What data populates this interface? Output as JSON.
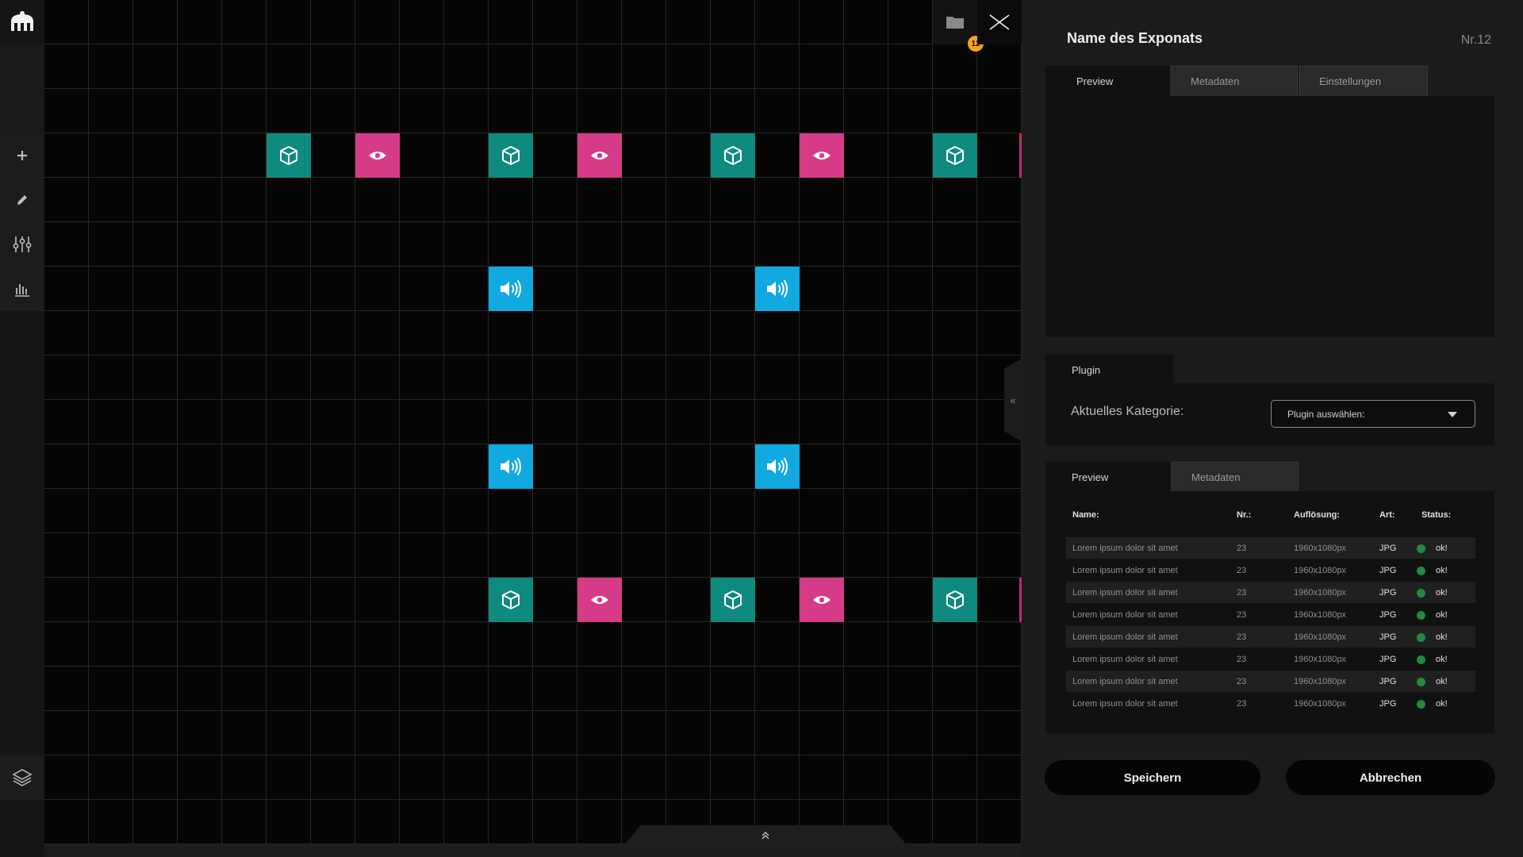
{
  "panel": {
    "title": "Name des Exponats",
    "number": "Nr.12",
    "top_tabs": [
      "Preview",
      "Metadaten",
      "Einstellungen"
    ],
    "plugin_tab": "Plugin",
    "category_label": "Aktuelles Kategorie:",
    "plugin_select_value": "Plugin auswählen:",
    "bottom_tabs": [
      "Preview",
      "Metadaten"
    ],
    "table": {
      "headers": [
        "Name:",
        "Nr.:",
        "Auflösung:",
        "Art:",
        "Status:"
      ],
      "rows": [
        {
          "name": "Lorem ipsum dolor sit amet",
          "nr": "23",
          "res": "1960x1080px",
          "art": "JPG",
          "status": "ok!"
        },
        {
          "name": "Lorem ipsum dolor sit amet",
          "nr": "23",
          "res": "1960x1080px",
          "art": "JPG",
          "status": "ok!"
        },
        {
          "name": "Lorem ipsum dolor sit amet",
          "nr": "23",
          "res": "1960x1080px",
          "art": "JPG",
          "status": "ok!"
        },
        {
          "name": "Lorem ipsum dolor sit amet",
          "nr": "23",
          "res": "1960x1080px",
          "art": "JPG",
          "status": "ok!"
        },
        {
          "name": "Lorem ipsum dolor sit amet",
          "nr": "23",
          "res": "1960x1080px",
          "art": "JPG",
          "status": "ok!"
        },
        {
          "name": "Lorem ipsum dolor sit amet",
          "nr": "23",
          "res": "1960x1080px",
          "art": "JPG",
          "status": "ok!"
        },
        {
          "name": "Lorem ipsum dolor sit amet",
          "nr": "23",
          "res": "1960x1080px",
          "art": "JPG",
          "status": "ok!"
        },
        {
          "name": "Lorem ipsum dolor sit amet",
          "nr": "23",
          "res": "1960x1080px",
          "art": "JPG",
          "status": "ok!"
        }
      ]
    },
    "save_label": "Speichern",
    "cancel_label": "Abbrechen"
  },
  "notifications_badge": "12",
  "colors": {
    "object_tile": "#0f8a7e",
    "view_tile": "#d63b87",
    "audio_tile": "#12a9e0",
    "status_ok": "#1f8a3e",
    "badge": "#f2a41c"
  },
  "icons": {
    "toolbar": [
      "logo-icon",
      "plus-icon",
      "pencil-icon",
      "sliders-icon",
      "bar-chart-icon",
      "layers-icon"
    ],
    "canvas_top": [
      "folder-icon",
      "close-x-icon"
    ],
    "tiles": [
      "cube-icon",
      "eye-icon",
      "speaker-icon"
    ]
  }
}
